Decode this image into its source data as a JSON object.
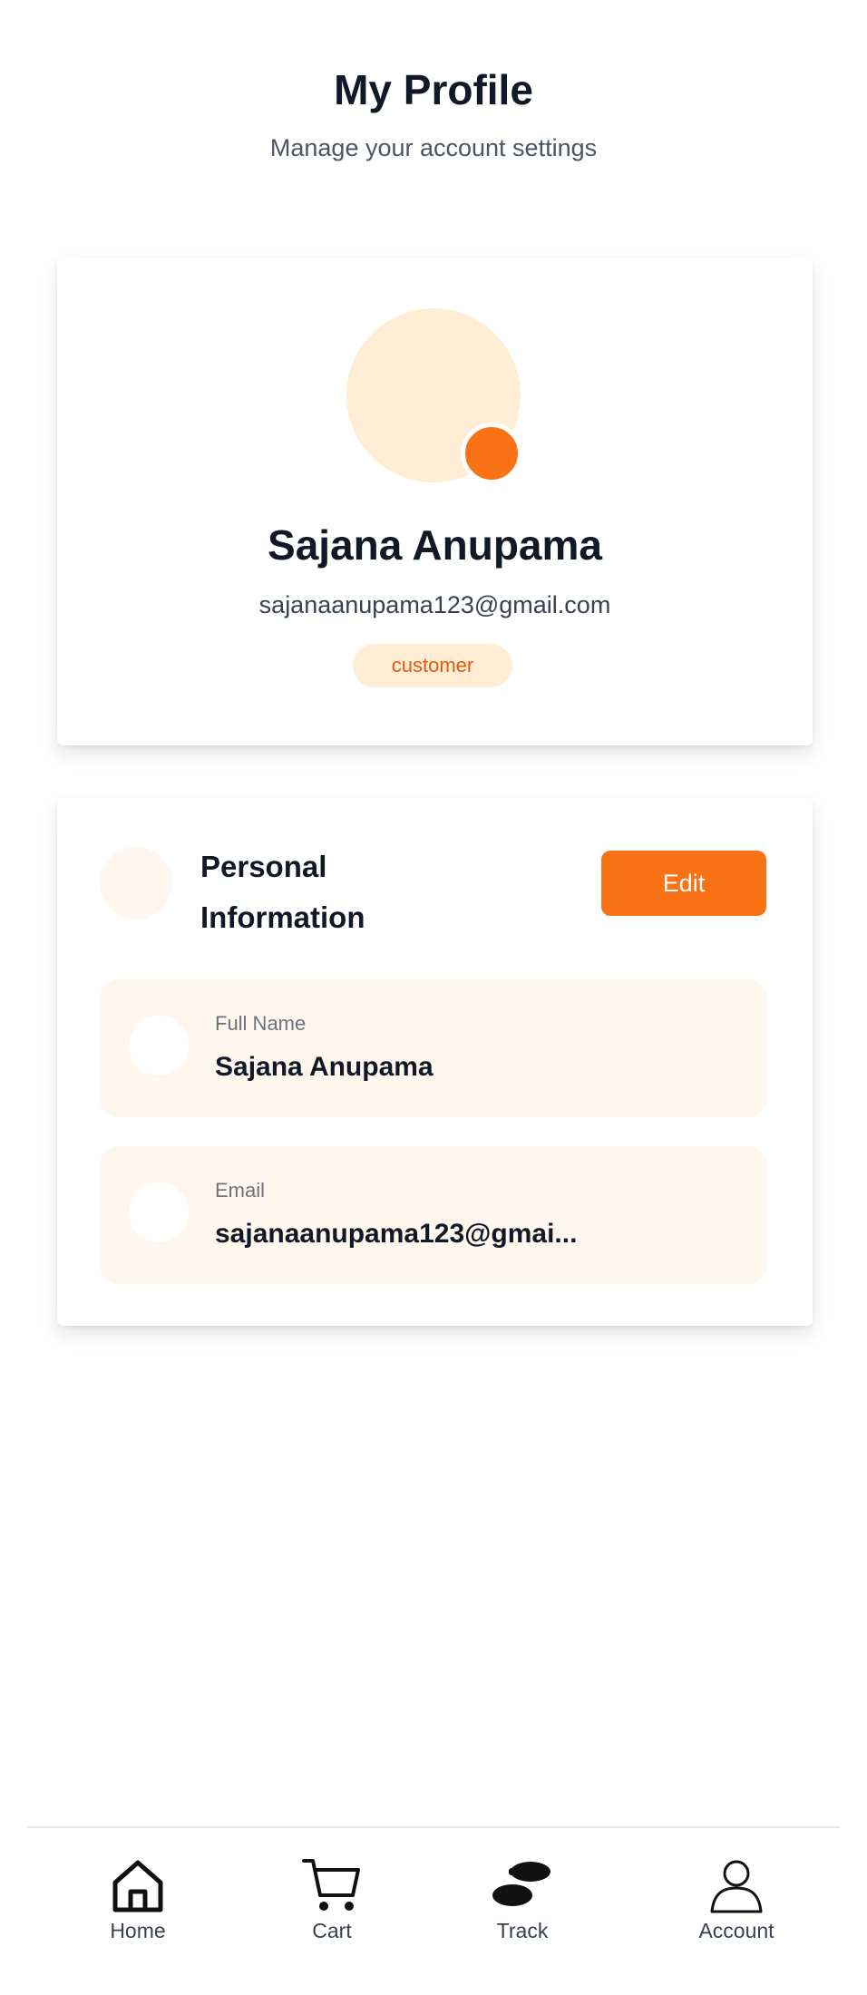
{
  "header": {
    "title": "My Profile",
    "subtitle": "Manage your account settings"
  },
  "profile": {
    "name": "Sajana Anupama",
    "email": "sajanaanupama123@gmail.com",
    "role": "customer"
  },
  "personal_info": {
    "title": "Personal Information",
    "edit_label": "Edit",
    "fields": [
      {
        "label": "Full Name",
        "value": "Sajana Anupama"
      },
      {
        "label": "Email",
        "value": "sajanaanupama123@gmai..."
      }
    ]
  },
  "bottom_nav": {
    "items": [
      {
        "label": "Home",
        "icon": "home-icon"
      },
      {
        "label": "Cart",
        "icon": "cart-icon"
      },
      {
        "label": "Track",
        "icon": "footsteps-icon"
      },
      {
        "label": "Account",
        "icon": "person-icon"
      }
    ]
  },
  "colors": {
    "accent": "#f97316",
    "accent_light": "#ffedd5",
    "field_bg": "#fff7ed",
    "text_primary": "#111827",
    "text_secondary": "#4b5563"
  }
}
